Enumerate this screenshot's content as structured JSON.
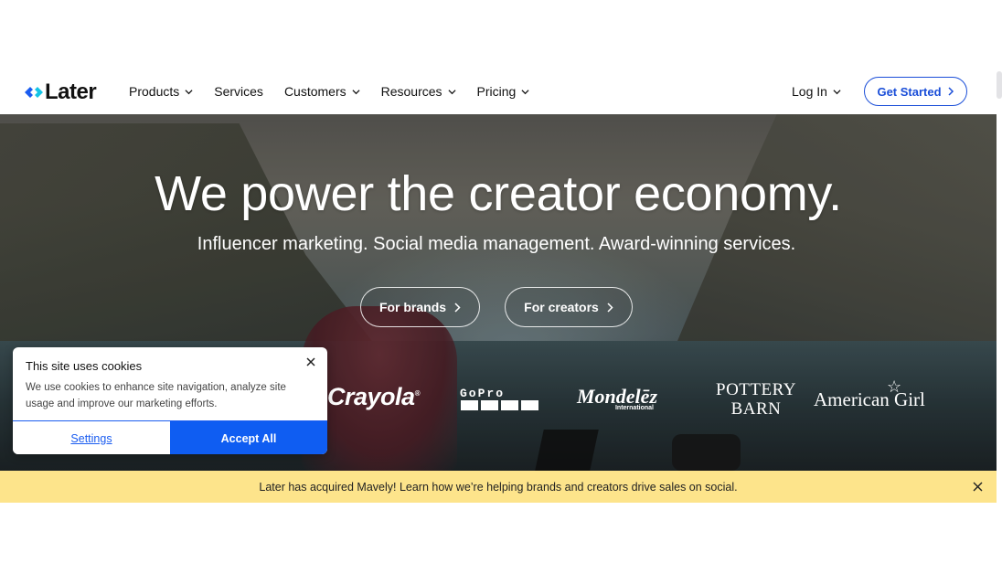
{
  "brand": {
    "name": "Later",
    "accent": "#1a4ed8"
  },
  "nav": {
    "items": [
      {
        "label": "Products",
        "has_dropdown": true
      },
      {
        "label": "Services",
        "has_dropdown": false
      },
      {
        "label": "Customers",
        "has_dropdown": true
      },
      {
        "label": "Resources",
        "has_dropdown": true
      },
      {
        "label": "Pricing",
        "has_dropdown": true
      }
    ],
    "login_label": "Log In",
    "cta_label": "Get Started"
  },
  "hero": {
    "headline": "We power the creator economy.",
    "subheadline": "Influencer marketing. Social media management. Award-winning services.",
    "buttons": [
      {
        "label": "For brands"
      },
      {
        "label": "For creators"
      }
    ],
    "logos": {
      "crayola": "Crayola",
      "gopro": "GoPro",
      "mondelez": "Mondelēz",
      "mondelez_sub": "International",
      "pottery_line1": "POTTERY",
      "pottery_line2": "BARN",
      "american_girl": "American Girl"
    }
  },
  "cookie": {
    "title": "This site uses cookies",
    "text": "We use cookies to enhance site navigation, analyze site usage and improve our marketing efforts.",
    "settings_label": "Settings",
    "accept_label": "Accept All",
    "accept_color": "#0f5df2"
  },
  "announcement": {
    "text": "Later has acquired Mavely! Learn how we’re helping brands and creators drive sales on social.",
    "background": "#fde48b"
  }
}
